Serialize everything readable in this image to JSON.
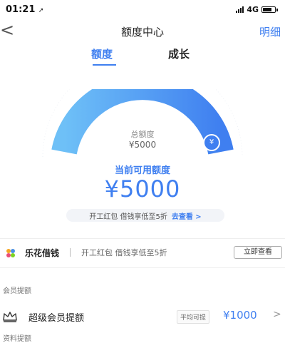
{
  "status_bar": {
    "time": "01:21",
    "network": "4G"
  },
  "nav": {
    "title": "额度中心",
    "right_label": "明细"
  },
  "tabs": [
    {
      "label": "额度"
    },
    {
      "label": "成长"
    }
  ],
  "gauge": {
    "total_label": "总额度",
    "total_value": "¥5000",
    "badge": "¥",
    "available_label": "当前可用额度",
    "available_amount": "¥5000",
    "colors": {
      "start": "#6ec0f7",
      "end": "#3f7ff0"
    }
  },
  "promo": {
    "text": "开工红包 借钱享低至5折",
    "link": "去查看 >"
  },
  "brand_row": {
    "name": "乐花借钱",
    "desc": "开工红包 借钱享低至5折",
    "button": "立即查看"
  },
  "sections": {
    "member_title": "会员提额",
    "member": {
      "label": "超级会员提额",
      "chip": "平均可提",
      "amount": "¥1000",
      "chevron": ">"
    },
    "profile_title": "资料提额"
  },
  "colors": {
    "accent": "#3f7ff0"
  }
}
